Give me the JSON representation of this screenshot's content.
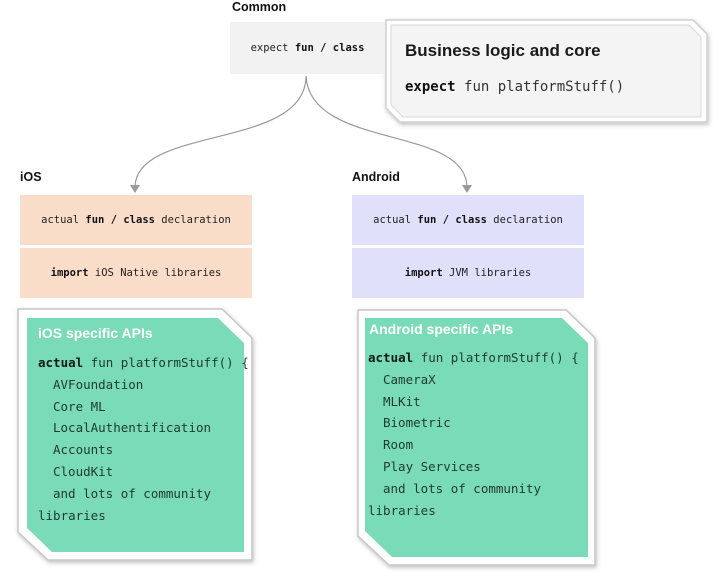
{
  "common": {
    "title": "Common",
    "box": {
      "prefix": "expect",
      "kw1": "fun",
      "sep": "/",
      "kw2": "class"
    }
  },
  "callout": {
    "title": "Business logic and core",
    "code_kw": "expect",
    "code_rest": "fun platformStuff()"
  },
  "ios": {
    "title": "iOS",
    "row1": {
      "prefix": "actual",
      "kw1": "fun",
      "sep": "/",
      "kw2": "class",
      "suffix": "declaration"
    },
    "row2": {
      "kw": "import",
      "rest": "iOS Native libraries"
    },
    "card": {
      "title": "iOS specific APIs",
      "first_kw": "actual",
      "first_rest": "fun platformStuff() {",
      "lines": [
        "AVFoundation",
        "Core ML",
        "LocalAuthentification",
        "Accounts",
        "CloudKit",
        "and lots of community"
      ],
      "last": "libraries"
    }
  },
  "android": {
    "title": "Android",
    "row1": {
      "prefix": "actual",
      "kw1": "fun",
      "sep": "/",
      "kw2": "class",
      "suffix": "declaration"
    },
    "row2": {
      "kw": "import",
      "rest": "JVM libraries"
    },
    "card": {
      "title": "Android specific APIs",
      "first_kw": "actual",
      "first_rest": "fun platformStuff() {",
      "lines": [
        "CameraX",
        "MLKit",
        "Biometric",
        "Room",
        "Play Services",
        "and lots of community"
      ],
      "last": "libraries"
    }
  },
  "colors": {
    "ios_row": "#f9ddc9",
    "android_row": "#e0e0fb",
    "card": "#79dbb8",
    "common_box": "#f2f2f2"
  }
}
